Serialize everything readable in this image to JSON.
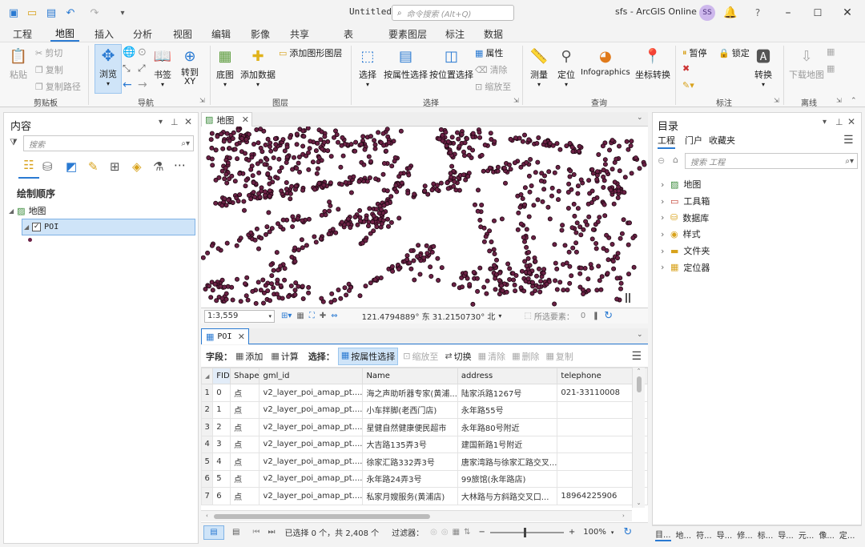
{
  "titlebar": {
    "title": "Untitled",
    "command_search_placeholder": "命令搜索 (Alt+Q)",
    "user_project": "sfs - ArcGIS Online",
    "avatar": "SS"
  },
  "tabs": [
    "工程",
    "地图",
    "插入",
    "分析",
    "视图",
    "编辑",
    "影像",
    "共享",
    "表",
    "要素图层",
    "标注",
    "数据"
  ],
  "ribbon": {
    "clipboard": {
      "paste": "粘贴",
      "cut": "剪切",
      "copy": "复制",
      "copy_path": "复制路径",
      "label": "剪贴板"
    },
    "navigate": {
      "explore": "浏览",
      "bookmarks": "书签",
      "goto_xy": "转到\nXY",
      "label": "导航"
    },
    "layer": {
      "basemap": "底图",
      "add_data": "添加数据",
      "add_graphics": "添加图形图层",
      "label": "图层"
    },
    "selection": {
      "select": "选择",
      "by_attr": "按属性选择",
      "by_loc": "按位置选择",
      "attributes": "属性",
      "clear": "清除",
      "zoom_to": "缩放至",
      "label": "选择"
    },
    "inquiry": {
      "measure": "测量",
      "locate": "定位",
      "infographics": "Infographics",
      "coord_convert": "坐标转换",
      "label": "查询"
    },
    "labeling": {
      "pause": "暂停",
      "lock": "锁定",
      "convert": "转换",
      "label": "标注"
    },
    "offline": {
      "download_map": "下载地图",
      "label": "离线"
    }
  },
  "contents": {
    "title": "内容",
    "search_placeholder": "搜索",
    "drawing_order": "绘制顺序",
    "map": "地图",
    "layer": "POI"
  },
  "map_view": {
    "tab": "地图",
    "scale": "1:3,559",
    "coords": "121.4794889° 东  31.2150730° 北",
    "selected_features": "所选要素：",
    "selected_count": "0"
  },
  "table_view": {
    "tab": "POI",
    "field_label": "字段：",
    "add": "添加",
    "calculate": "计算",
    "selection_label": "选择：",
    "select_by_attr": "按属性选择",
    "zoom_to": "缩放至",
    "switch": "切换",
    "clear": "清除",
    "delete": "删除",
    "copy": "复制",
    "columns": [
      "FID",
      "Shape",
      "gml_id",
      "Name",
      "address",
      "telephone"
    ],
    "rows": [
      [
        "1",
        "0",
        "点",
        "v2_layer_poi_amap_pt....",
        "海之声助听器专家(黄浦...",
        "陆家浜路1267号",
        "021-33110008"
      ],
      [
        "2",
        "1",
        "点",
        "v2_layer_poi_amap_pt....",
        "小车拌脚(老西门店)",
        "永年路55号",
        ""
      ],
      [
        "3",
        "2",
        "点",
        "v2_layer_poi_amap_pt....",
        "星健自然健康便民超市",
        "永年路80号附近",
        ""
      ],
      [
        "4",
        "3",
        "点",
        "v2_layer_poi_amap_pt....",
        "大吉路135弄3号",
        "建国新路1号附近",
        ""
      ],
      [
        "5",
        "4",
        "点",
        "v2_layer_poi_amap_pt....",
        "徐家汇路332弄3号",
        "唐家湾路与徐家汇路交叉...",
        ""
      ],
      [
        "6",
        "5",
        "点",
        "v2_layer_poi_amap_pt....",
        "永年路24弄3号",
        "99旅馆(永年路店)",
        ""
      ],
      [
        "7",
        "6",
        "点",
        "v2_layer_poi_amap_pt....",
        "私家月嫂服务(黄浦店)",
        "大林路与方斜路交叉口...",
        "18964225906"
      ]
    ],
    "status": "已选择 0 个，共 2,408 个",
    "filter_label": "过滤器：",
    "zoom": "100%"
  },
  "catalog": {
    "title": "目录",
    "tabs": [
      "工程",
      "门户",
      "收藏夹"
    ],
    "search_placeholder": "搜索 工程",
    "items": [
      "地图",
      "工具箱",
      "数据库",
      "样式",
      "文件夹",
      "定位器"
    ]
  },
  "bottom_tabs": [
    "目...",
    "地...",
    "符...",
    "导...",
    "修...",
    "标...",
    "导...",
    "元...",
    "像...",
    "定..."
  ],
  "colors": {
    "accent": "#2a7ad2",
    "points_fill": "#6b2145",
    "points_stroke": "#1d0812",
    "avatar_bg": "#cdb7ec"
  }
}
